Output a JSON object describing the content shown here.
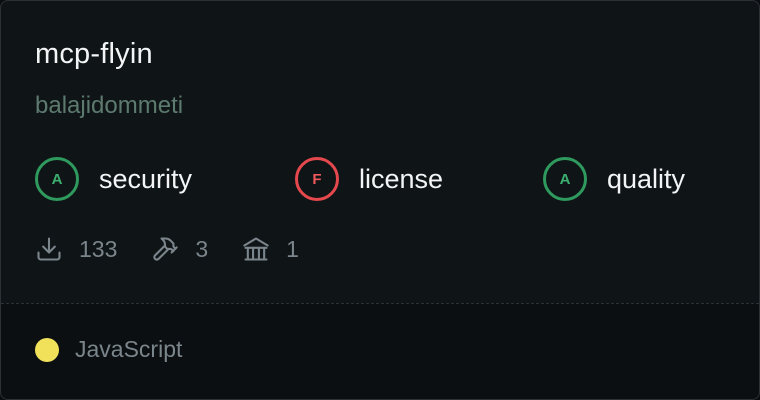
{
  "card": {
    "title": "mcp-flyin",
    "owner": "balajidommeti"
  },
  "grades": [
    {
      "grade": "A",
      "label": "security",
      "status": "good",
      "color": "#2f9a5e"
    },
    {
      "grade": "F",
      "label": "license",
      "status": "bad",
      "color": "#e5484d"
    },
    {
      "grade": "A",
      "label": "quality",
      "status": "good",
      "color": "#2f9a5e"
    }
  ],
  "stats": {
    "downloads": {
      "icon": "download-icon",
      "value": "133"
    },
    "tools": {
      "icon": "hammer-icon",
      "value": "3"
    },
    "resources": {
      "icon": "bank-icon",
      "value": "1"
    }
  },
  "language": {
    "name": "JavaScript",
    "color": "#f1e05a"
  }
}
